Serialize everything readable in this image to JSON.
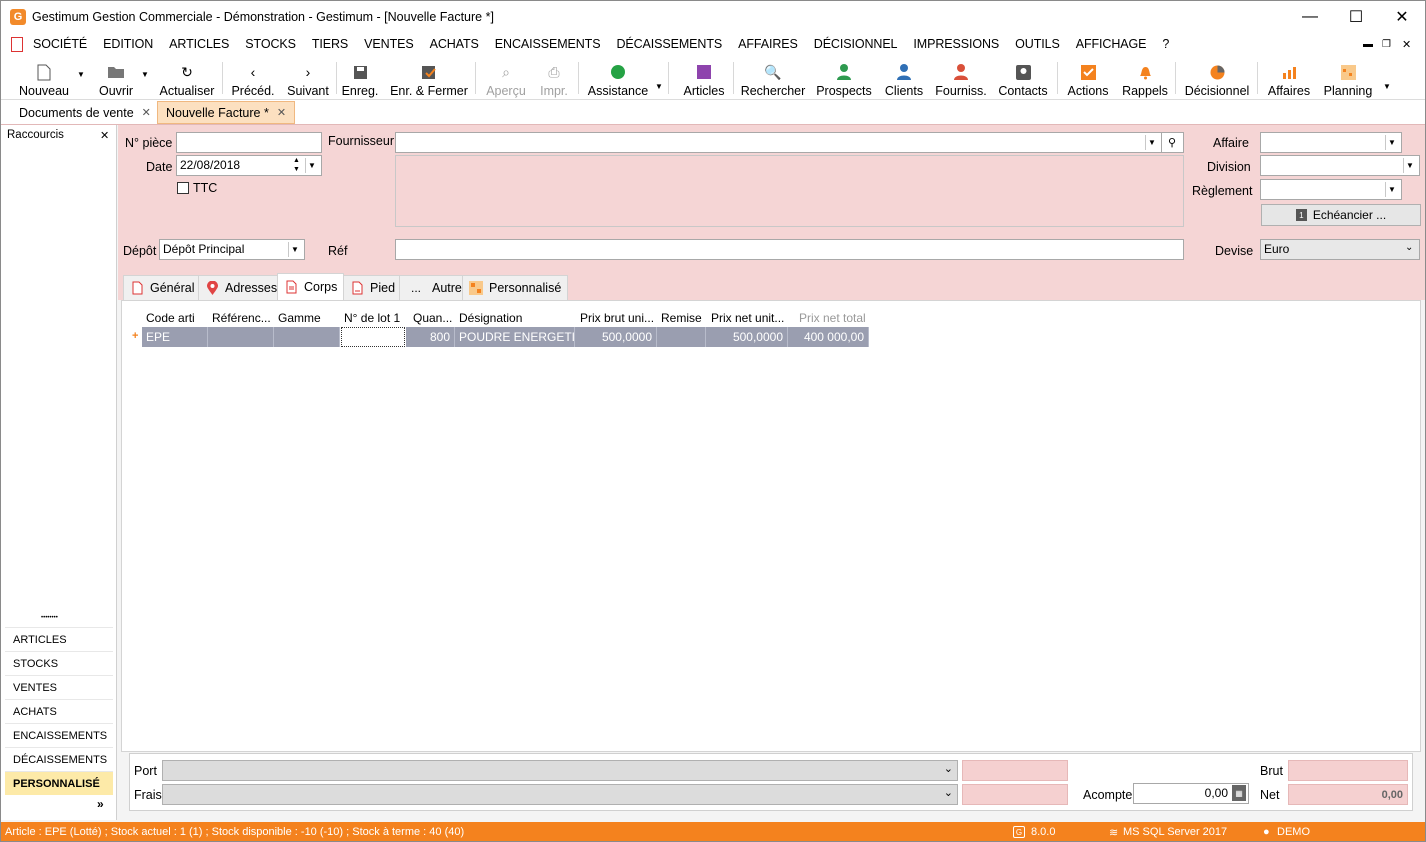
{
  "window": {
    "title": "Gestimum Gestion Commerciale - Démonstration - Gestimum - [Nouvelle Facture *]",
    "app_icon_letter": "G",
    "minimize": "—",
    "maximize": "☐",
    "close": "✕"
  },
  "menu": [
    "SOCIÉTÉ",
    "EDITION",
    "ARTICLES",
    "STOCKS",
    "TIERS",
    "VENTES",
    "ACHATS",
    "ENCAISSEMENTS",
    "DÉCAISSEMENTS",
    "AFFAIRES",
    "DÉCISIONNEL",
    "IMPRESSIONS",
    "OUTILS",
    "AFFICHAGE",
    "?"
  ],
  "toolbar": {
    "nouveau": "Nouveau",
    "ouvrir": "Ouvrir",
    "actualiser": "Actualiser",
    "preced": "Précéd.",
    "suivant": "Suivant",
    "enreg": "Enreg.",
    "enr_fermer": "Enr. & Fermer",
    "apercu": "Aperçu",
    "impr": "Impr.",
    "assistance": "Assistance",
    "articles": "Articles",
    "rechercher": "Rechercher",
    "prospects": "Prospects",
    "clients": "Clients",
    "fourniss": "Fourniss.",
    "contacts": "Contacts",
    "actions": "Actions",
    "rappels": "Rappels",
    "decisionnel": "Décisionnel",
    "affaires": "Affaires",
    "planning": "Planning"
  },
  "doc_tabs": {
    "tab1": "Documents de vente",
    "tab2": "Nouvelle Facture *"
  },
  "sidebar": {
    "title": "Raccourcis",
    "close": "✕",
    "grip": "••••••••",
    "items": [
      "ARTICLES",
      "STOCKS",
      "VENTES",
      "ACHATS",
      "ENCAISSEMENTS",
      "DÉCAISSEMENTS",
      "PERSONNALISÉ"
    ],
    "more": "»"
  },
  "form": {
    "npiece_label": "N° pièce",
    "npiece_value": "",
    "date_label": "Date",
    "date_value": "22/08/2018",
    "ttc_label": "TTC",
    "fournisseur_label": "Fournisseur",
    "fournisseur_value": "",
    "affaire_label": "Affaire",
    "division_label": "Division",
    "reglement_label": "Règlement",
    "echeancier_label": "Echéancier ...",
    "depot_label": "Dépôt",
    "depot_value": "Dépôt Principal",
    "ref_label": "Réf",
    "ref_value": "",
    "devise_label": "Devise",
    "devise_value": "Euro"
  },
  "tabs": [
    "Général",
    "Adresses",
    "Corps",
    "Pied",
    "Autre",
    "Personnalisé"
  ],
  "tab_icon_autre": "...",
  "grid": {
    "columns": [
      "Code arti",
      "Référenc...",
      "Gamme",
      "N° de lot 1",
      "Quan...",
      "Désignation",
      "Prix brut uni...",
      "Remise",
      "Prix net unit...",
      "Prix net total"
    ],
    "rows": [
      {
        "marker": "+",
        "code": "EPE",
        "reference": "",
        "gamme": "",
        "lot": "",
        "quantite": "800",
        "designation": "POUDRE ENERGETI...",
        "prix_brut": "500,0000",
        "remise": "",
        "prix_net": "500,0000",
        "total": "400 000,00"
      }
    ]
  },
  "footer": {
    "port_label": "Port",
    "frais_label": "Frais",
    "acompte_label": "Acompte",
    "acompte_value": "0,00",
    "brut_label": "Brut",
    "net_label": "Net",
    "net_value": "0,00"
  },
  "status": {
    "text": "Article : EPE (Lotté) ; Stock actuel : 1 (1) ; Stock disponible : -10 (-10) ; Stock à terme : 40 (40)",
    "version": "8.0.0",
    "db": "MS SQL Server 2017",
    "user": "DEMO"
  },
  "colors": {
    "accent": "#f4821e",
    "form_bg": "#f5d5d5",
    "grid_row": "#9a9eb0",
    "selected_tab": "#fce0c0"
  }
}
